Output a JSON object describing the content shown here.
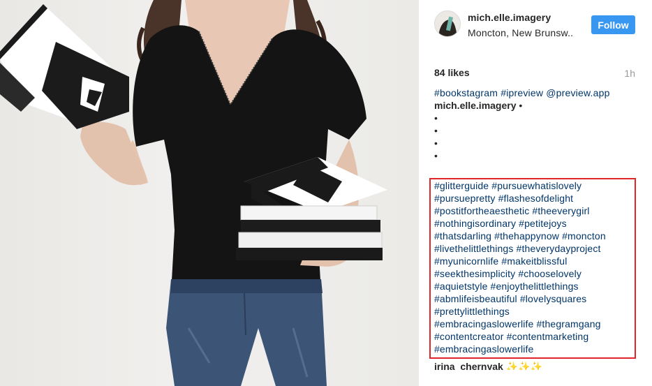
{
  "post": {
    "username": "mich.elle.imagery",
    "location": "Moncton, New Brunsw..",
    "follow_label": "Follow",
    "likes": "84 likes",
    "time": "1h"
  },
  "caption": {
    "tagline": "#bookstagram #ipreview @preview.app",
    "author": "mich.elle.imagery",
    "author_suffix": " •",
    "bullets": [
      "•",
      "•",
      "•",
      "•"
    ]
  },
  "hashtag_lines": [
    "#glitterguide #pursuewhatislovely",
    "#pursuepretty #flashesofdelight",
    "#postitfortheaesthetic #theeverygirl",
    "#nothingisordinary #petitejoys",
    "#thatsdarling #thehappynow #moncton",
    "#livethelittlethings #theverydayproject",
    "#myunicornlife #makeitblissful",
    "#seekthesimplicity #chooselovely",
    "#aquietstyle #enjoythelittlethings",
    "#abmlifeisbeautiful #lovelysquares",
    "#prettylittlethings",
    "#embracingaslowerlife #thegramgang",
    "#contentcreator #contentmarketing",
    "#embracingaslowerlife"
  ],
  "comment": {
    "username": "irina_chernyak",
    "emoji": "✨✨✨"
  },
  "colors": {
    "follow_bg": "#3897f0",
    "hashtag": "#003569",
    "highlight_border": "#e0262b",
    "time": "#999999"
  }
}
